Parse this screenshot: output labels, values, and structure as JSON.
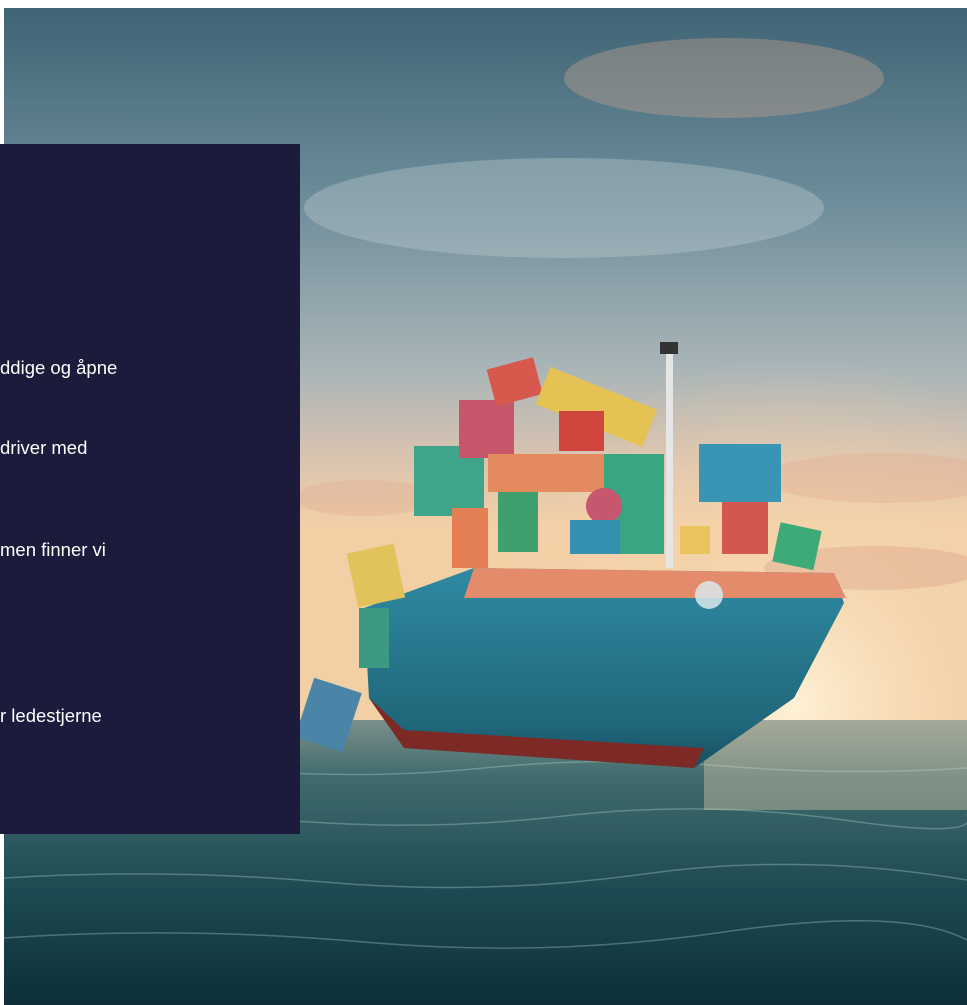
{
  "hero": {
    "alt_subject": "container-ship-at-sea",
    "colors": {
      "panel_bg": "#1c1b3b",
      "hull": "#2c7f96",
      "hull_bottom": "#8c2a26",
      "sea_dark": "#0f3b45",
      "sky_top": "#4d6f80",
      "sunset": "#f1c49c"
    }
  },
  "panel": {
    "lines": [
      "ddige og åpne",
      "driver med",
      "men finner vi",
      "r ledestjerne"
    ]
  }
}
